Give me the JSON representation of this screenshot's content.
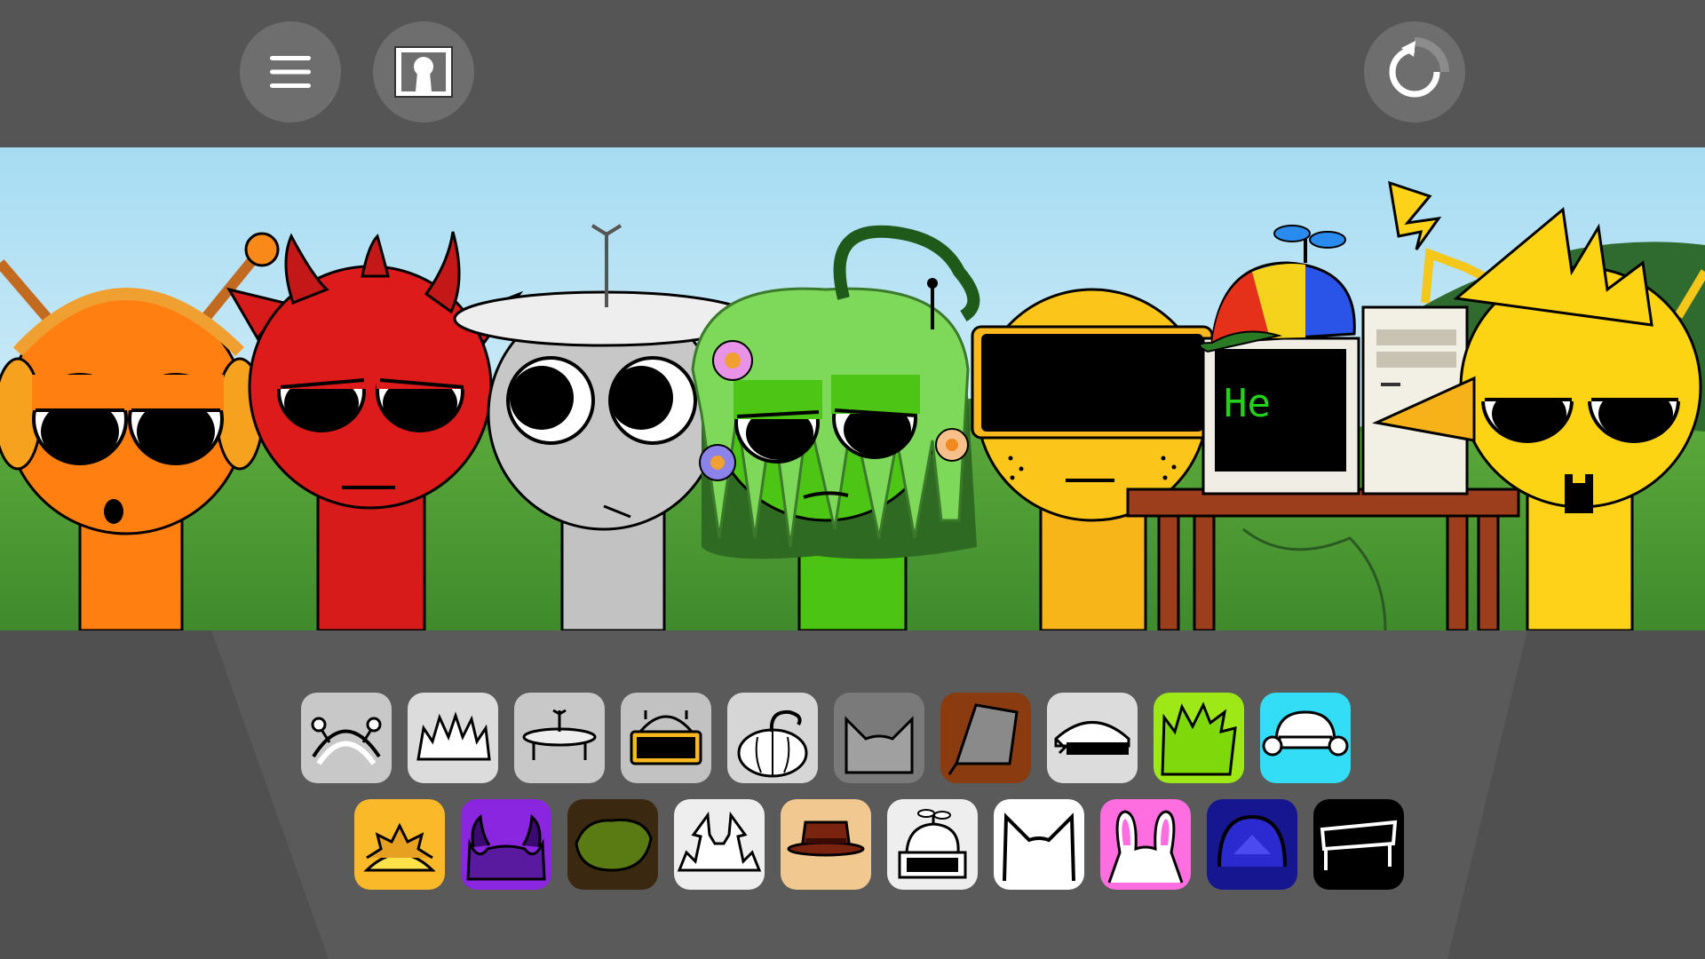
{
  "topbar": {
    "menu_icon": "hamburger-menu-icon",
    "character_icon": "keyhole-portrait-icon",
    "reset_icon": "reset-loop-icon"
  },
  "stage": {
    "screen_text": "He",
    "characters": [
      "orange-headphones",
      "red-devil",
      "gray-dish",
      "green-vines",
      "yellow-visor",
      "yellow-spiky"
    ]
  },
  "picker": {
    "row1": [
      {
        "name": "antenna-headband",
        "bg": "#c8c8c8"
      },
      {
        "name": "spiky-hair",
        "bg": "#dcdcdc"
      },
      {
        "name": "satellite-dish",
        "bg": "#c8c8c8"
      },
      {
        "name": "visor",
        "bg": "#c2c2c2"
      },
      {
        "name": "pumpkin",
        "bg": "#d6d6d6"
      },
      {
        "name": "cat-ears",
        "bg": "#7a7a7a"
      },
      {
        "name": "bucket",
        "bg": "#8a3b10"
      },
      {
        "name": "computer",
        "bg": "#dcdcdc"
      },
      {
        "name": "green-spikes",
        "bg": "#9ee817"
      },
      {
        "name": "headphones",
        "bg": "#33ddf5"
      }
    ],
    "row2": [
      {
        "name": "sun-crown",
        "bg": "#f9b928"
      },
      {
        "name": "purple-horns",
        "bg": "#8a25e0"
      },
      {
        "name": "bush",
        "bg": "#3b2810"
      },
      {
        "name": "lightning",
        "bg": "#eeeeee"
      },
      {
        "name": "brown-hat",
        "bg": "#f0c890"
      },
      {
        "name": "propeller-cap",
        "bg": "#eeeeee"
      },
      {
        "name": "white-cat-ears",
        "bg": "#ffffff"
      },
      {
        "name": "bunny-ears",
        "bg": "#ff6ee0"
      },
      {
        "name": "dark-dome",
        "bg": "#161690"
      },
      {
        "name": "bench",
        "bg": "#000000"
      }
    ]
  }
}
